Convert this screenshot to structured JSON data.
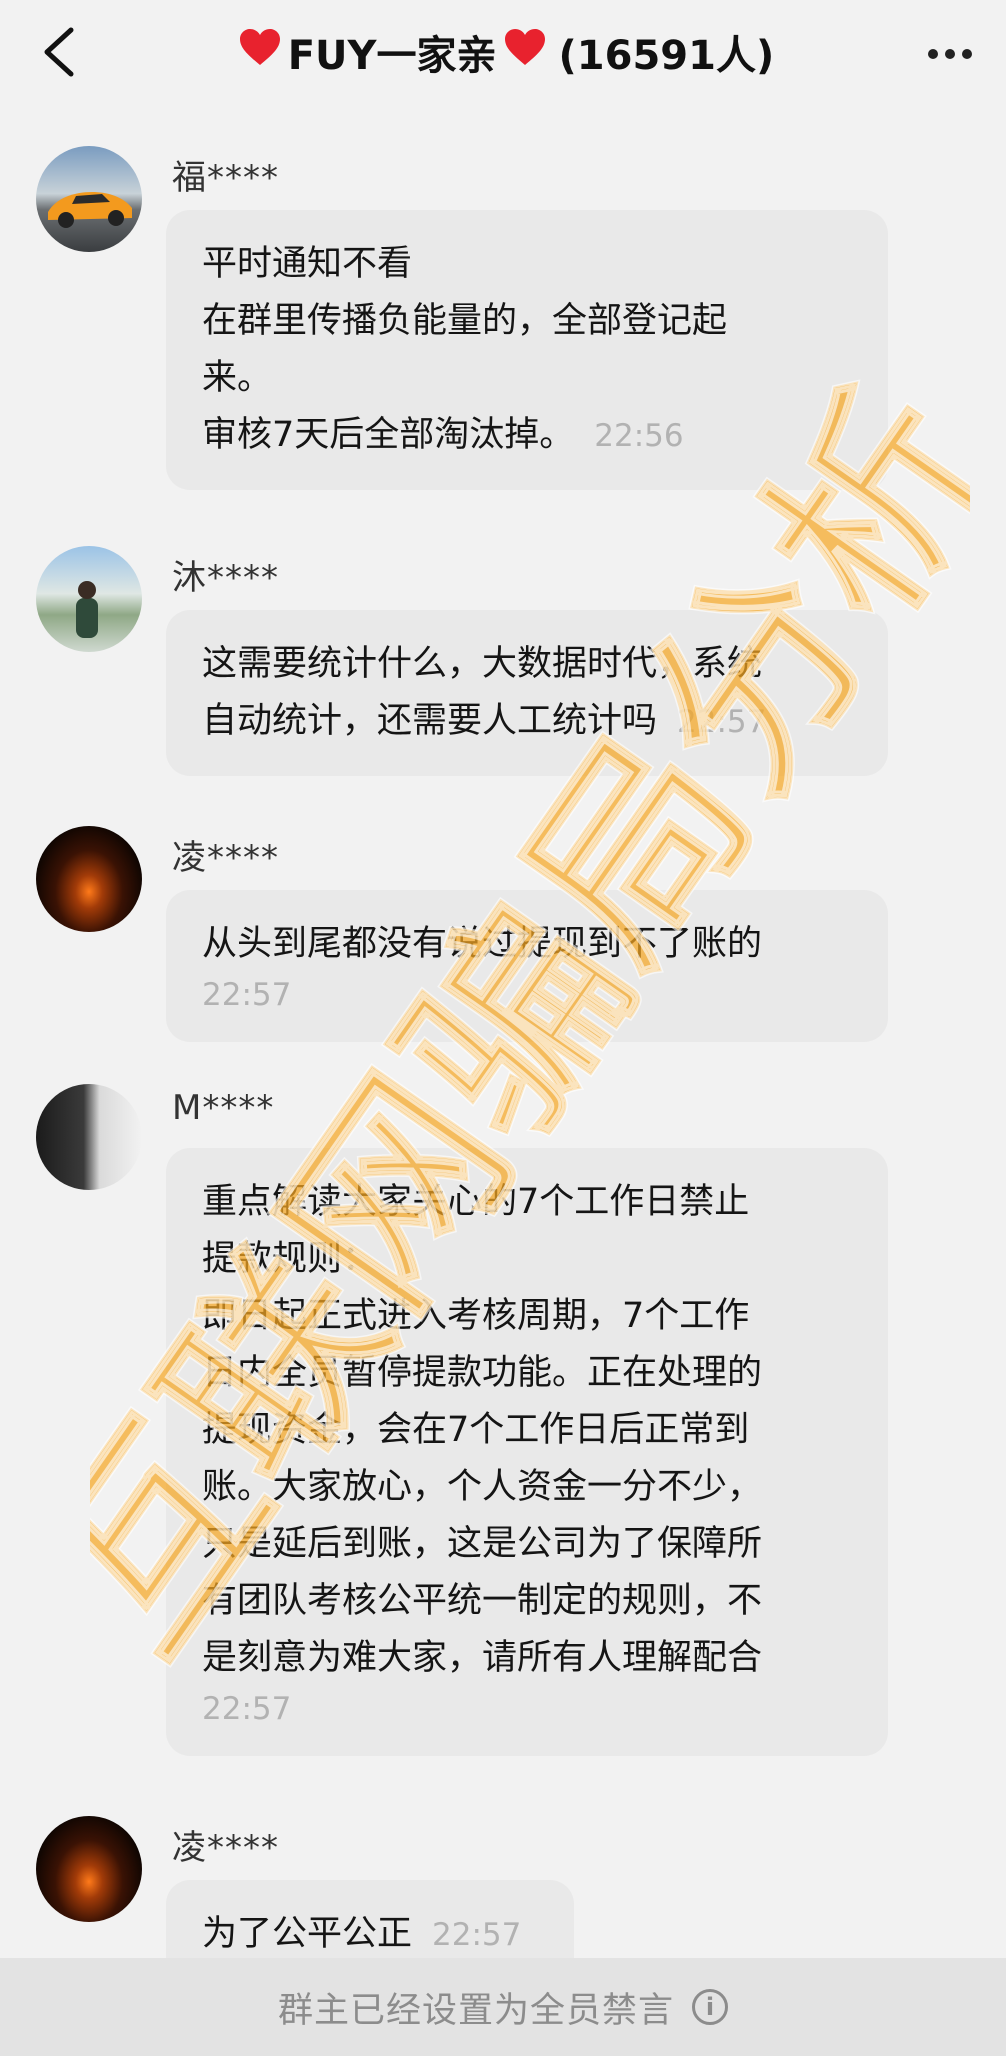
{
  "header": {
    "title": "FUY一家亲",
    "member_count": "(16591人)",
    "heart_icon": "❤"
  },
  "messages": [
    {
      "sender": "福****",
      "avatar_icon": "orange-sports-car-avatar",
      "lines": [
        "平时通知不看",
        "在群里传播负能量的，全部登记起",
        "来。",
        "审核7天后全部淘汰掉。"
      ],
      "time": "22:56"
    },
    {
      "sender": "沐****",
      "avatar_icon": "lakeside-person-avatar",
      "lines": [
        "这需要统计什么，大数据时代，系统",
        "自动统计，还需要人工统计吗"
      ],
      "time": "22:57"
    },
    {
      "sender": "凌****",
      "avatar_icon": "sunset-avatar",
      "lines": [
        "从头到尾都没有说过提现到不了账的"
      ],
      "time": "22:57"
    },
    {
      "sender": "M****",
      "avatar_icon": "calligraphy-avatar",
      "lines": [
        "重点解读大家关心的7个工作日禁止",
        "提款规则：",
        "即日起正式进入考核周期，7个工作",
        "日内全员暂停提款功能。正在处理的",
        "提现资金，会在7个工作日后正常到",
        "账。大家放心，个人资金一分不少，",
        "只是延后到账，这是公司为了保障所",
        "有团队考核公平统一制定的规则，不",
        "是刻意为难大家，请所有人理解配合"
      ],
      "time": "22:57"
    },
    {
      "sender": "凌****",
      "avatar_icon": "sunset-avatar",
      "lines": [
        "为了公平公正"
      ],
      "time": "22:57"
    }
  ],
  "watermark": {
    "text": "互联网骗局分析",
    "color": "#f5a623"
  },
  "footer": {
    "notice": "群主已经设置为全员禁言",
    "info_icon": "i"
  },
  "colors": {
    "background": "#f2f2f2",
    "bubble": "#e9e9e9",
    "timestamp": "#b2b2b2",
    "footer_bg": "#e3e3e3"
  }
}
